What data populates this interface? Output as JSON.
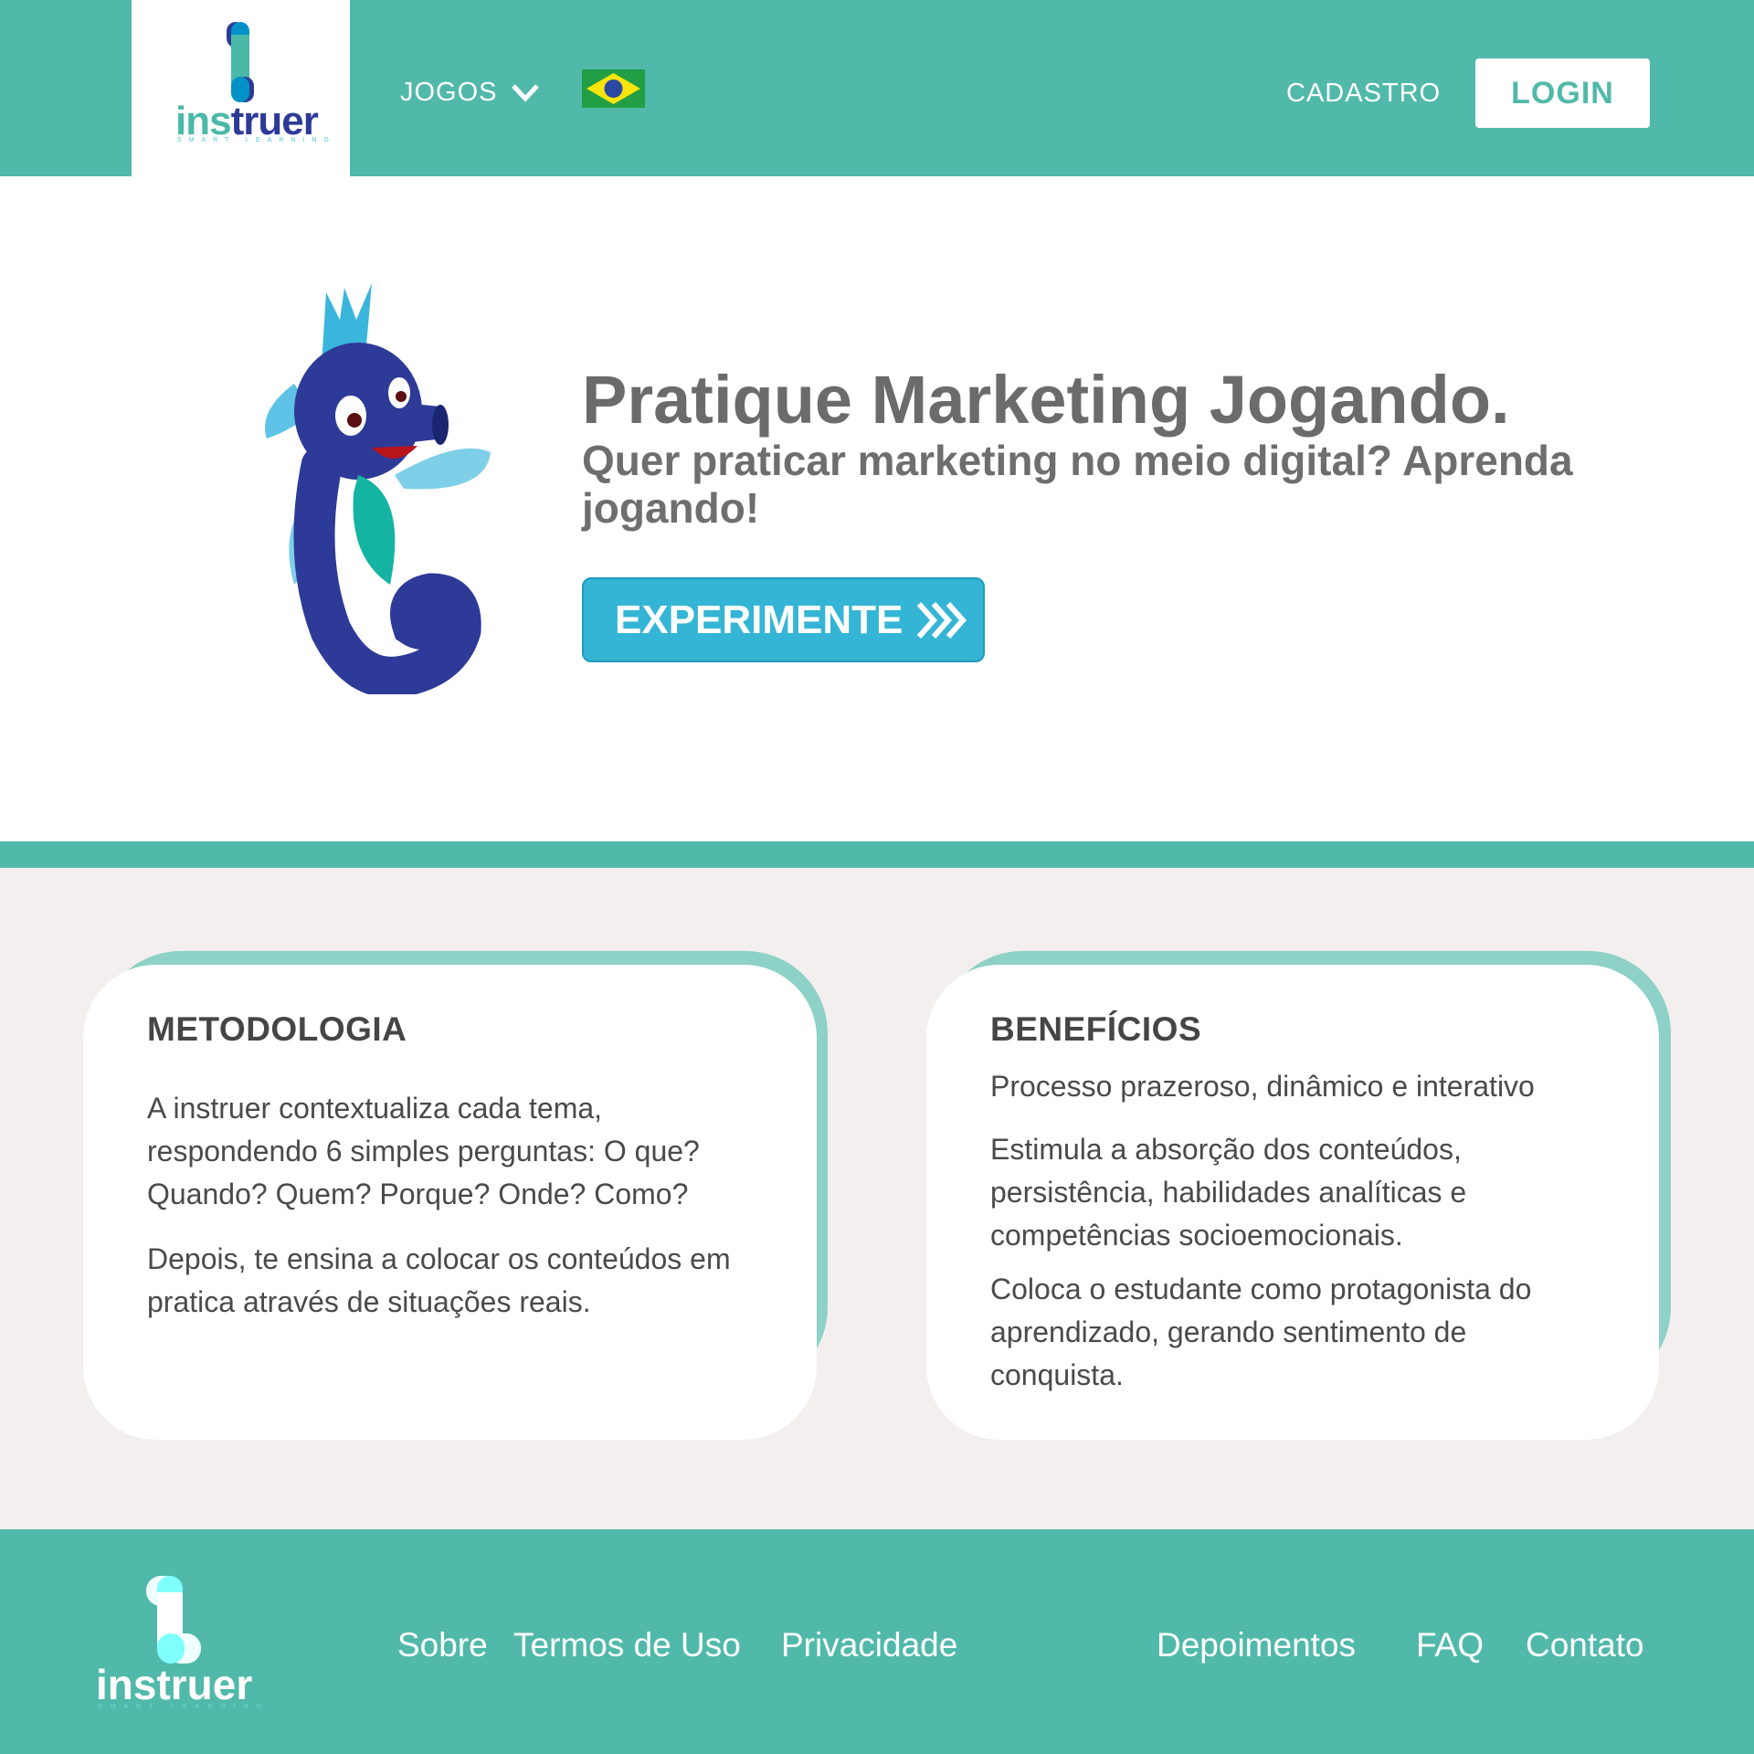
{
  "header": {
    "logo_text": "instruer",
    "logo_tagline": "SMART LEARNING",
    "nav_games": "JOGOS",
    "language_flag": "brazil-flag",
    "signup": "CADASTRO",
    "login": "LOGIN"
  },
  "hero": {
    "title": "Pratique Marketing Jogando.",
    "subtitle": "Quer praticar marketing no meio digital? Aprenda jogando!",
    "cta": "EXPERIMENTE"
  },
  "cards": [
    {
      "title": "METODOLOGIA",
      "paragraphs": [
        "A instruer contextualiza cada tema, respondendo 6 simples perguntas:  O que? Quando? Quem? Porque? Onde? Como?",
        "Depois, te ensina a colocar os conteúdos em pratica através de situações reais."
      ]
    },
    {
      "title": "BENEFÍCIOS",
      "paragraphs": [
        "Processo prazeroso, dinâmico e interativo",
        "Estimula a absorção dos conteúdos, persistência, habilidades analíticas e competências socioemocionais.",
        "Coloca o estudante como protagonista do aprendizado, gerando sentimento de conquista."
      ]
    }
  ],
  "footer": {
    "logo_text": "instruer",
    "logo_tagline": "SMART LEARNING",
    "links": [
      "Sobre",
      "Termos de Uso",
      "Privacidade",
      "Depoimentos",
      "FAQ",
      "Contato"
    ]
  },
  "colors": {
    "primary": "#51b9aa",
    "cta": "#35b5d6",
    "navy": "#2e3a97",
    "section_bg": "#f2efee"
  }
}
